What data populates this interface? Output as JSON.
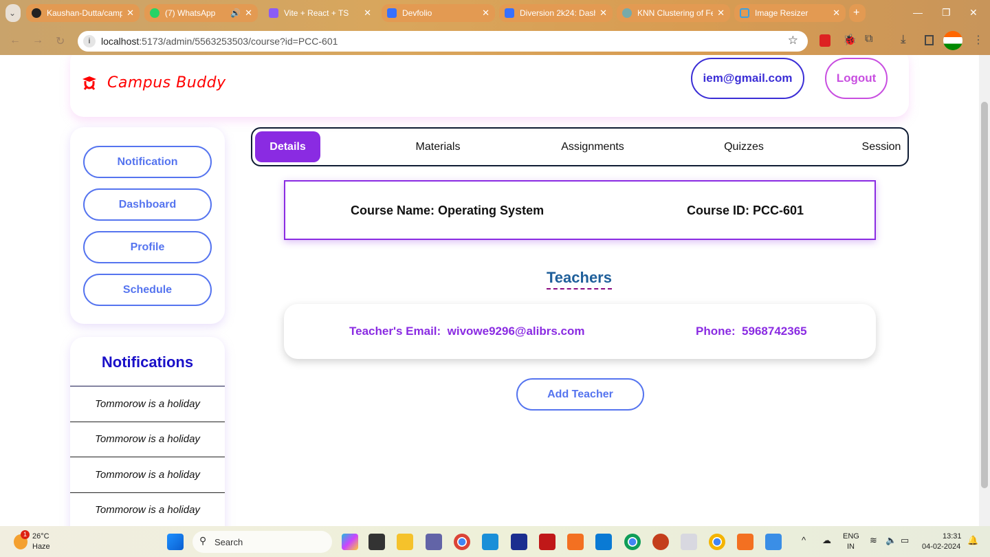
{
  "browser": {
    "tabs": [
      {
        "title": "Kaushan-Dutta/camp",
        "icon": "github-icon",
        "color": "#222"
      },
      {
        "title": "(7) WhatsApp",
        "icon": "whatsapp-icon",
        "color": "#25d366"
      },
      {
        "title": "Vite + React + TS",
        "icon": "vite-icon",
        "color": "#8b5cf6"
      },
      {
        "title": "Devfolio",
        "icon": "devfolio-icon",
        "color": "#3770ff"
      },
      {
        "title": "Diversion 2k24: Dash",
        "icon": "devfolio-icon",
        "color": "#3770ff"
      },
      {
        "title": "KNN Clustering of Fe",
        "icon": "openai-icon",
        "color": "#7aa"
      },
      {
        "title": "Image Resizer",
        "icon": "image-icon",
        "color": "#3aa0e0"
      }
    ],
    "url_host": "localhost",
    "url_rest": ":5173/admin/5563253503/course?id=PCC-601"
  },
  "header": {
    "brand": "Campus Buddy",
    "brand_color": "#ff0000",
    "email": "iem@gmail.com",
    "logout": "Logout"
  },
  "sidebar": {
    "items": [
      "Notification",
      "Dashboard",
      "Profile",
      "Schedule"
    ]
  },
  "notifications": {
    "title": "Notifications",
    "items": [
      "Tommorow is a holiday",
      "Tommorow is a holiday",
      "Tommorow is a holiday",
      "Tommorow is a holiday"
    ]
  },
  "tabs": {
    "items": [
      "Details",
      "Materials",
      "Assignments",
      "Quizzes",
      "Session"
    ],
    "active": "Details",
    "accent": "#8a2be2"
  },
  "course": {
    "name": "Course Name: Operating System",
    "id": "Course ID: PCC-601"
  },
  "teachers": {
    "title": "Teachers",
    "email": "Teacher's Email:  wivowe9296@alibrs.com",
    "phone": "Phone:  5968742365",
    "add": "Add Teacher"
  },
  "taskbar": {
    "temp": "26°C",
    "weather": "Haze",
    "badge": "1",
    "search": "Search",
    "lang1": "ENG",
    "lang2": "IN",
    "time": "13:31",
    "date": "04-02-2024"
  }
}
